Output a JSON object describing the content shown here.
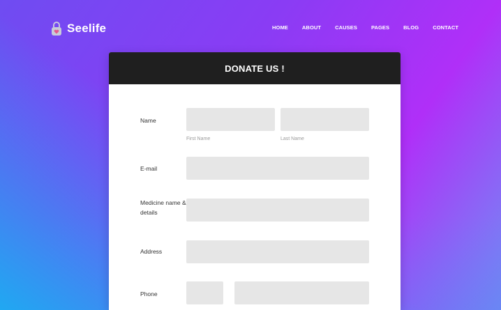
{
  "brand": {
    "name": "Seelife",
    "icon": "heart-lock-icon"
  },
  "nav": {
    "items": [
      "HOME",
      "ABOUT",
      "CAUSES",
      "PAGES",
      "BLOG",
      "CONTACT"
    ]
  },
  "form": {
    "title": "DONATE US !",
    "name_label": "Name",
    "first_name_hint": "First Name",
    "last_name_hint": "Last Name",
    "email_label": "E-mail",
    "medicine_label": "Medicine name & details",
    "address_label": "Address",
    "phone_label": "Phone",
    "first_name_value": "",
    "last_name_value": "",
    "email_value": "",
    "medicine_value": "",
    "address_value": "",
    "phone_code_value": "",
    "phone_number_value": ""
  }
}
